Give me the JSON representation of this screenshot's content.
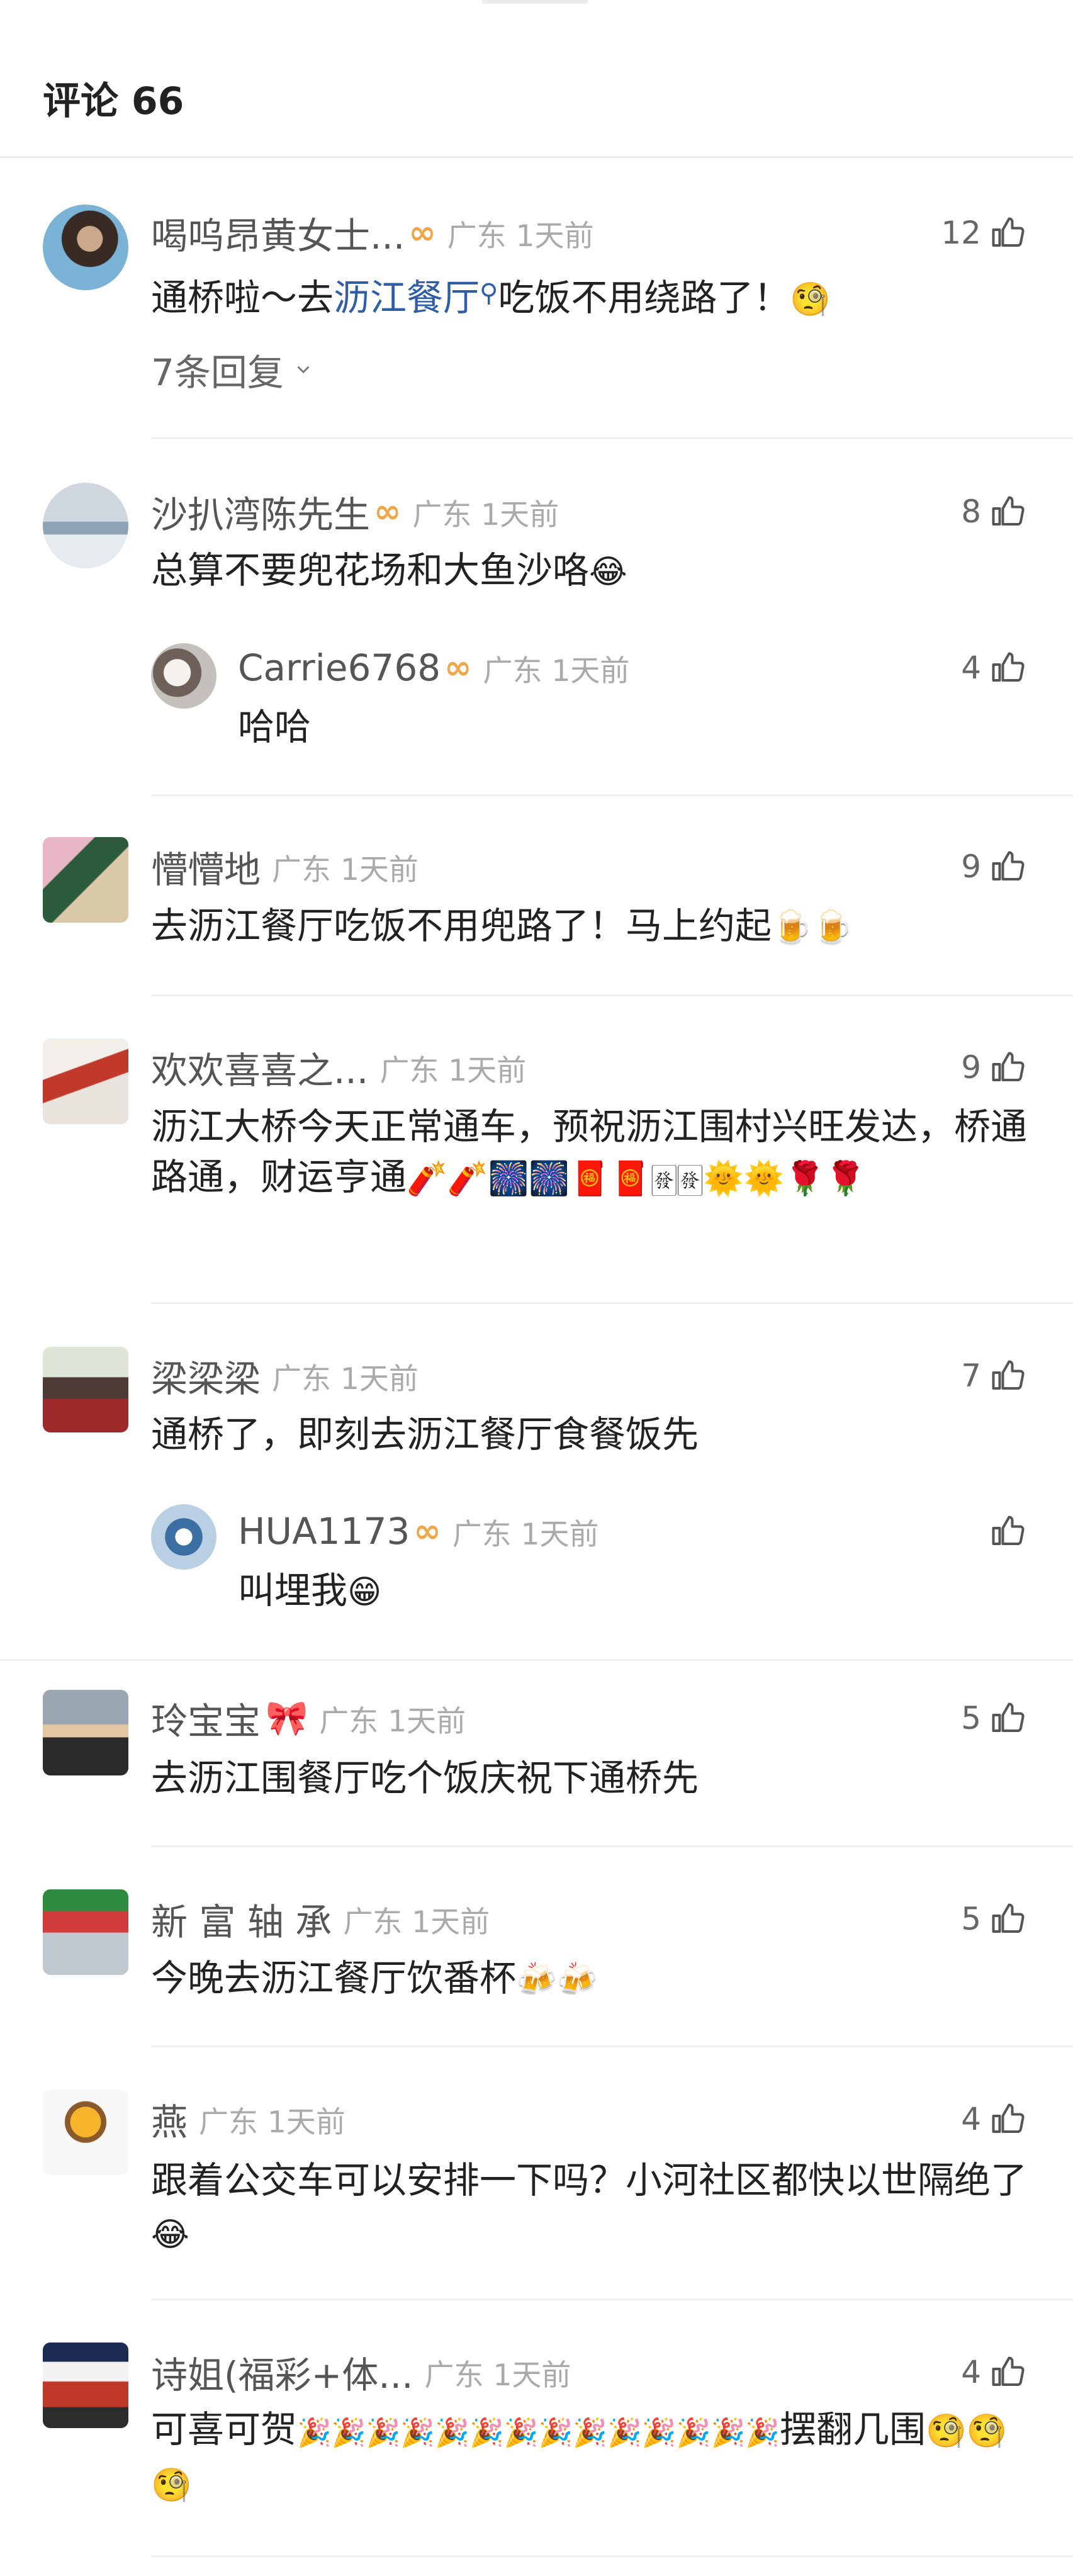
{
  "header": {
    "title": "评论 66"
  },
  "comments": [
    {
      "name": "喝呜昂黄女士...",
      "meta": "广东 1天前",
      "likes": "12",
      "text_before": "通桥啦～去",
      "link": "沥江餐厅",
      "text_after": "吃饭不用绕路了！",
      "emoji": "🧐",
      "replies_link": "7条回复"
    },
    {
      "name": "沙扒湾陈先生",
      "meta": "广东 1天前",
      "likes": "8",
      "text": "总算不要兜花场和大鱼沙咯",
      "emoji": "😂",
      "reply": {
        "name": "Carrie6768",
        "meta": "广东 1天前",
        "likes": "4",
        "text": "哈哈"
      }
    },
    {
      "name": "懵懵地",
      "meta": "广东 1天前",
      "likes": "9",
      "text": "去沥江餐厅吃饭不用兜路了！马上约起",
      "emoji": "🍺🍺"
    },
    {
      "name": "欢欢喜喜之...",
      "meta": "广东 1天前",
      "likes": "9",
      "text": "沥江大桥今天正常通车，预祝沥江围村兴旺发达，桥通路通，财运亨通",
      "emoji": "🧨🧨🎆🎆🧧🧧🀅🀅🌞🌞🌹🌹"
    },
    {
      "name": "梁梁梁",
      "meta": "广东 1天前",
      "likes": "7",
      "text": "通桥了，即刻去沥江餐厅食餐饭先",
      "reply": {
        "name": "HUA1173",
        "meta": "广东 1天前",
        "likes": "",
        "text": "叫埋我",
        "emoji": "😁"
      }
    },
    {
      "name": "玲宝宝",
      "meta": "广东 1天前",
      "likes": "5",
      "text": "去沥江围餐厅吃个饭庆祝下通桥先"
    },
    {
      "name": "新 富 轴 承",
      "meta": "广东 1天前",
      "likes": "5",
      "text": "今晚去沥江餐厅饮番杯",
      "emoji": "🍻🍻"
    },
    {
      "name": "燕",
      "meta": "广东 1天前",
      "likes": "4",
      "text": "跟着公交车可以安排一下吗？小河社区都快以世隔绝了",
      "emoji": "😂"
    },
    {
      "name": "诗姐(福彩+体...",
      "meta": "广东 1天前",
      "likes": "4",
      "text": "可喜可贺",
      "emoji_mid": "🎉🎉🎉🎉🎉🎉🎉🎉🎉🎉🎉🎉🎉🎉",
      "text_after": "摆翻几围",
      "emoji": "🧐🧐🧐"
    }
  ],
  "icons": {
    "like": "thumbs-up-outline-icon",
    "vip_badge": "vip-infinity-badge-icon",
    "search": "search-magnifier-icon",
    "chevron": "chevron-down-icon"
  },
  "colors": {
    "link": "#2f5ea6",
    "badge": "#f0a64a",
    "meta": "#aaaaaa",
    "divider": "#efefef"
  }
}
